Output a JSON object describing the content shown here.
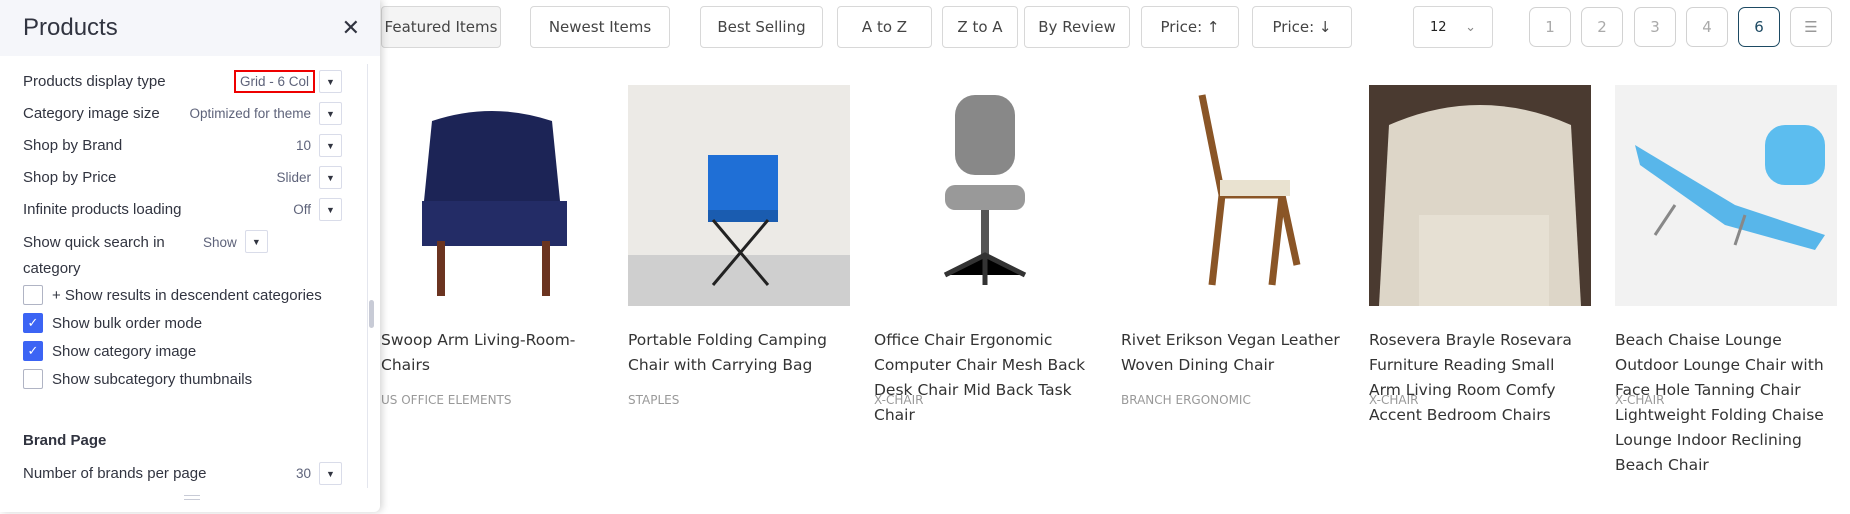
{
  "panel": {
    "title": "Products",
    "close_icon": "close-icon",
    "settings": [
      {
        "label": "Products display type",
        "value": "Grid - 6 Col"
      },
      {
        "label": "Category image size",
        "value": "Optimized for theme"
      },
      {
        "label": "Shop by Brand",
        "value": "10"
      },
      {
        "label": "Shop by Price",
        "value": "Slider"
      },
      {
        "label": "Infinite products loading",
        "value": "Off"
      },
      {
        "label": "Show quick search in category",
        "value": "Show"
      }
    ],
    "checkboxes": [
      {
        "label": "+ Show results in descendent categories",
        "checked": false
      },
      {
        "label": "Show bulk order mode",
        "checked": true
      },
      {
        "label": "Show category image",
        "checked": true
      },
      {
        "label": "Show subcategory thumbnails",
        "checked": false
      }
    ],
    "brand_section": "Brand Page",
    "brand_setting": {
      "label": "Number of brands per page",
      "value": "30"
    }
  },
  "sort_buttons": [
    "Featured Items",
    "Newest Items",
    "Best Selling",
    "A to Z",
    "Z to A",
    "By Review",
    "Price: ↑",
    "Price: ↓"
  ],
  "per_page": "12",
  "pages": [
    "1",
    "2",
    "3",
    "4",
    "6"
  ],
  "current_page": "6",
  "accent": "#3c64f4",
  "products": [
    {
      "title": "Swoop Arm Living-Room-Chairs",
      "brand": "US OFFICE ELEMENTS"
    },
    {
      "title": "Portable Folding Camping Chair with Carrying Bag",
      "brand": "STAPLES"
    },
    {
      "title": "Office Chair Ergonomic Computer Chair Mesh Back Desk Chair Mid Back Task Chair",
      "brand": "X-CHAIR"
    },
    {
      "title": "Rivet Erikson Vegan Leather Woven Dining Chair",
      "brand": "BRANCH ERGONOMIC"
    },
    {
      "title": "Rosevera Brayle Rosevara Furniture Reading Small Arm Living Room Comfy Accent Bedroom Chairs",
      "brand": "X-CHAIR"
    },
    {
      "title": "Beach Chaise Lounge Outdoor Lounge Chair with Face Hole Tanning Chair Lightweight Folding Chaise Lounge Indoor Reclining Beach Chair",
      "brand": "X-CHAIR"
    }
  ]
}
